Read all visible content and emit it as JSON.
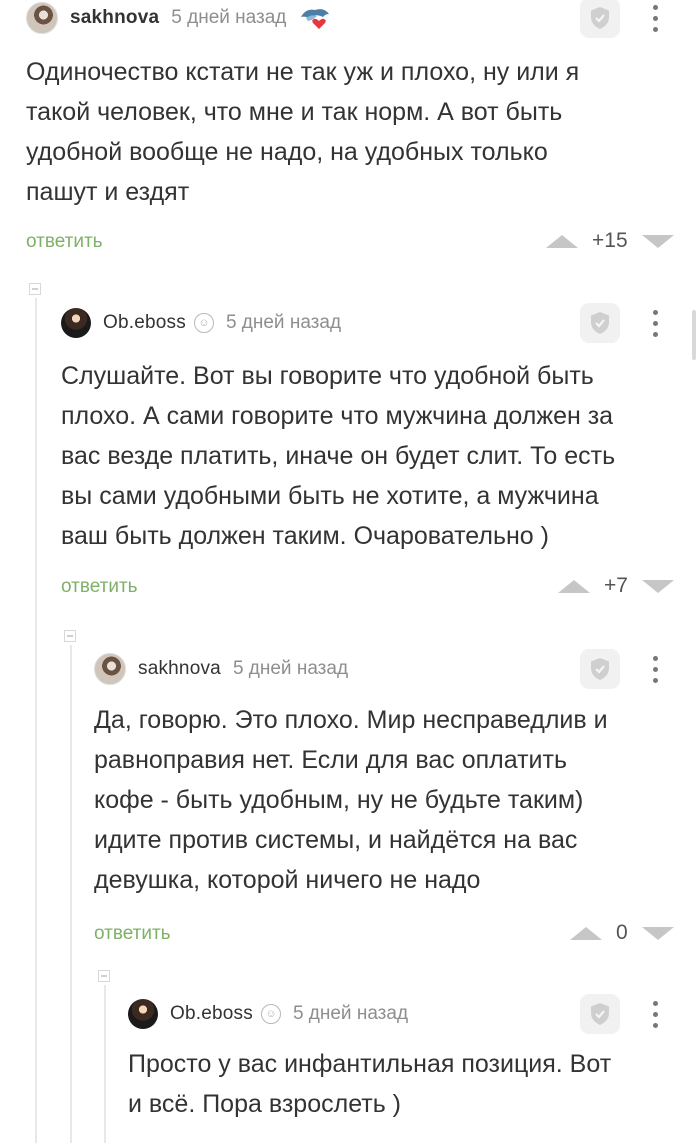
{
  "icons": {
    "shield": "shield-icon",
    "menu": "kebab-menu-icon",
    "award": "award-badge-icon",
    "subscribe": "subscriber-icon"
  },
  "colors": {
    "reply": "#7fb068",
    "text": "#333333",
    "muted": "#8e8e8e"
  },
  "comments": [
    {
      "username": "sakhnova",
      "time": "5 дней назад",
      "text": "Одиночество кстати не так уж и плохо, ну или я\nтакой человек, что мне и так норм. А вот быть\nудобной вообще не надо, на удобных только\nпашут и ездят",
      "reply_label": "ответить",
      "rating": "+15"
    },
    {
      "username": "Ob.eboss",
      "time": "5 дней назад",
      "text": "Слушайте. Вот вы говорите что удобной быть\nплохо. А сами говорите что мужчина должен за\nвас везде платить, иначе он будет слит. То есть\nвы сами удобными быть не хотите, а мужчина\nваш быть должен таким. Очаровательно )",
      "reply_label": "ответить",
      "rating": "+7"
    },
    {
      "username": "sakhnova",
      "time": "5 дней назад",
      "text": "Да, говорю. Это плохо. Мир несправедлив и\nравноправия нет. Если для вас оплатить\nкофе - быть удобным, ну не будьте таким)\nидите против системы, и найдётся на вас\nдевушка, которой ничего не надо",
      "reply_label": "ответить",
      "rating": "0"
    },
    {
      "username": "Ob.eboss",
      "time": "5 дней назад",
      "text": "Просто у вас инфантильная позиция. Вот\nи всё. Пора взрослеть )"
    }
  ]
}
